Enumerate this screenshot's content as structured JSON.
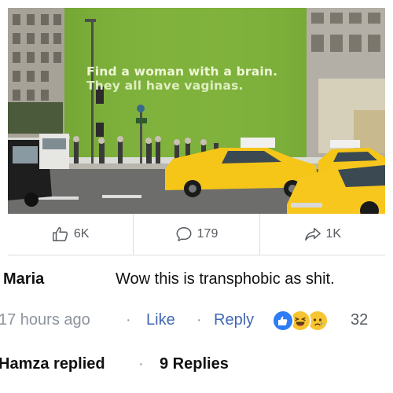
{
  "post": {
    "image": {
      "billboard_line1": "Find a woman with a brain.",
      "billboard_line2": "They all have vaginas."
    },
    "actions": {
      "likes": "6K",
      "comments": "179",
      "shares": "1K"
    }
  },
  "comment": {
    "author": "Maria",
    "text": "Wow this is transphobic as shit.",
    "time": "17 hours ago",
    "separator": "·",
    "like_label": "Like",
    "reply_label": "Reply",
    "reactions": [
      "like-icon",
      "laugh-icon",
      "sad-icon"
    ],
    "reaction_count": "32",
    "replies": {
      "replier": "Hamza replied",
      "count_label": "9 Replies"
    }
  },
  "colors": {
    "link": "#4267b2",
    "like_blue": "#2e7cf6",
    "emoji_yellow": "#f7c531",
    "muted": "#8d949e",
    "billboard_green": "#7fb23c",
    "taxi_yellow": "#f5c518"
  }
}
